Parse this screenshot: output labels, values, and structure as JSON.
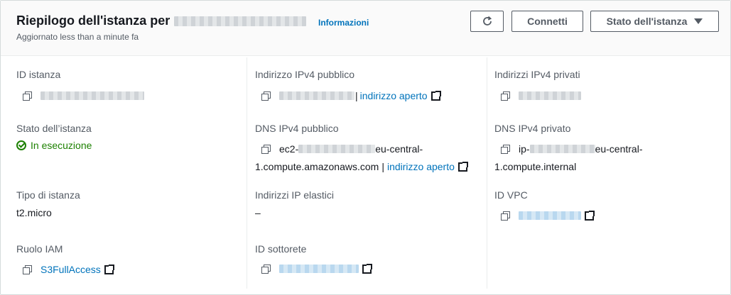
{
  "header": {
    "title": "Riepilogo dell'istanza per",
    "info_link": "Informazioni",
    "subtitle": "Aggiornato less than a minute fa",
    "refresh_icon": "refresh-icon",
    "connect_label": "Connetti",
    "state_label": "Stato dell'istanza"
  },
  "col1": {
    "instance_id_label": "ID istanza",
    "state_label": "Stato dell’istanza",
    "state_value": "In esecuzione",
    "type_label": "Tipo di istanza",
    "type_value": "t2.micro",
    "iam_label": "Ruolo IAM",
    "iam_value": "S3FullAccess"
  },
  "col2": {
    "public_ipv4_label": "Indirizzo IPv4 pubblico",
    "open_address": "indirizzo aperto",
    "public_dns_label": "DNS IPv4 pubblico",
    "public_dns_prefix": "ec2-",
    "public_dns_suffix": "eu-central-",
    "public_dns_line2": "1.compute.amazonaws.com",
    "open_address2": "indirizzo aperto",
    "elastic_label": "Indirizzi IP elastici",
    "elastic_value": "–",
    "subnet_label": "ID sottorete"
  },
  "col3": {
    "private_ipv4_label": "Indirizzi IPv4 privati",
    "private_dns_label": "DNS IPv4 privato",
    "private_dns_prefix": "ip-",
    "private_dns_suffix": "eu-central-",
    "private_dns_line2": "1.compute.internal",
    "vpc_label": "ID VPC"
  },
  "colors": {
    "link": "#0073bb",
    "success": "#1d8102",
    "label": "#545b64"
  }
}
